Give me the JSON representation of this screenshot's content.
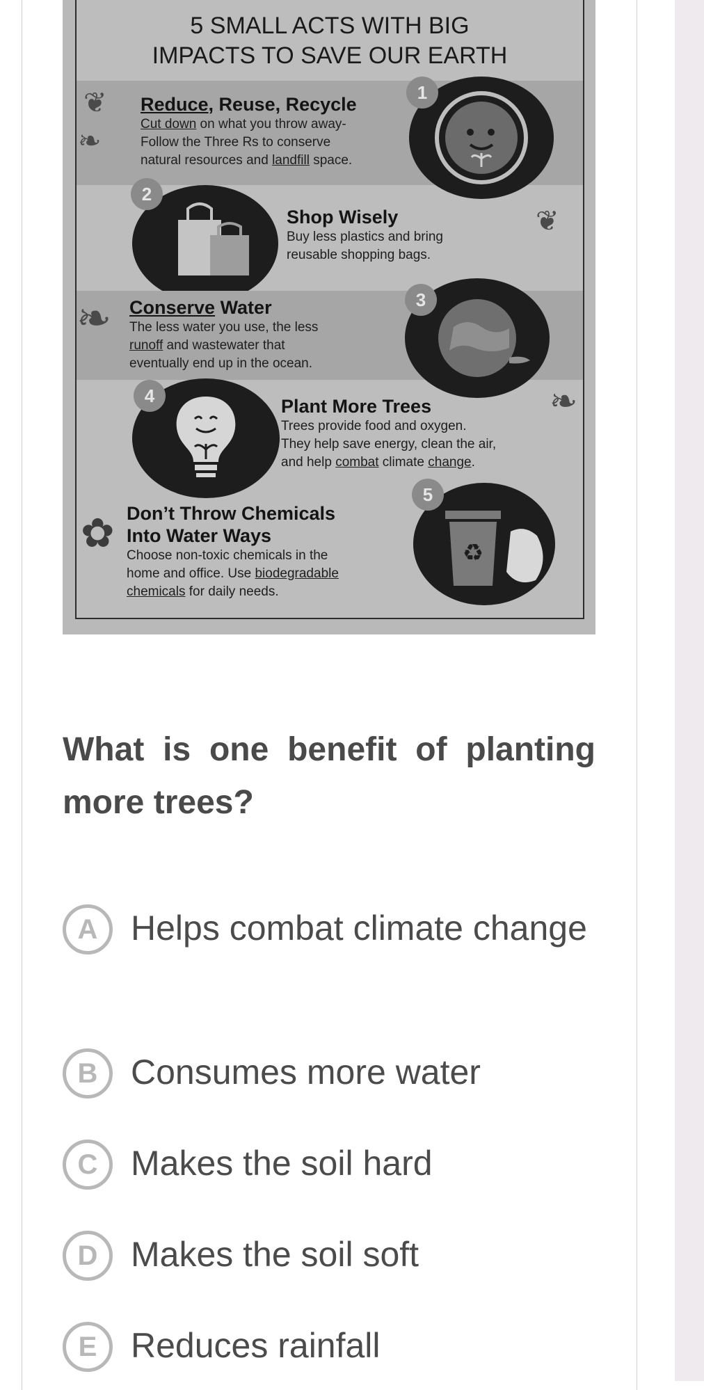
{
  "poster": {
    "title_line1": "5 SMALL ACTS WITH BIG",
    "title_line2": "IMPACTS TO SAVE OUR EARTH",
    "acts": [
      {
        "number": "1",
        "title_a": "Reduce",
        "title_b": ", Reuse, Recycle",
        "line1_a": "Cut down",
        "line1_b": " on what you throw away-",
        "line2": "Follow the Three Rs to conserve",
        "line3_a": "natural resources and ",
        "line3_b": "landfill",
        "line3_c": " space."
      },
      {
        "number": "2",
        "title": "Shop Wisely",
        "line1": "Buy less plastics and bring",
        "line2": "reusable shopping bags."
      },
      {
        "number": "3",
        "title_a": "Conserve",
        "title_b": " Water",
        "line1": "The less water you use, the less",
        "line2_a": "runoff",
        "line2_b": " and wastewater that",
        "line3": "eventually end up in the ocean."
      },
      {
        "number": "4",
        "title": "Plant More Trees",
        "line1": "Trees provide food and oxygen.",
        "line2": "They help save energy, clean the air,",
        "line3_a": "and help ",
        "line3_b": "combat",
        "line3_c": " climate ",
        "line3_d": "change",
        "line3_e": "."
      },
      {
        "number": "5",
        "title_line1": "Don’t Throw Chemicals",
        "title_line2": "Into Water Ways",
        "line1": "Choose non-toxic chemicals in the",
        "line2_a": "home and office. Use ",
        "line2_b": "biodegradable",
        "line3_a": "chemicals",
        "line3_b": " for daily needs."
      }
    ]
  },
  "question": "What is one benefit of planting more trees?",
  "options": [
    {
      "letter": "A",
      "text": "Helps combat climate change"
    },
    {
      "letter": "B",
      "text": "Consumes more water"
    },
    {
      "letter": "C",
      "text": "Makes the soil hard"
    },
    {
      "letter": "D",
      "text": "Makes the soil soft"
    },
    {
      "letter": "E",
      "text": "Reduces rainfall"
    }
  ],
  "colors": {
    "question_text": "#4a4a4a",
    "option_text": "#4b4b4b",
    "option_circle": "#b8b8b8",
    "side_strip": "#eeeaee"
  },
  "icons": [
    "bullet-point-1",
    "shopping-bag-icon",
    "earth-icon",
    "lightbulb-plant-icon",
    "trash-bin-recycle-icon",
    "leaf-icon"
  ]
}
